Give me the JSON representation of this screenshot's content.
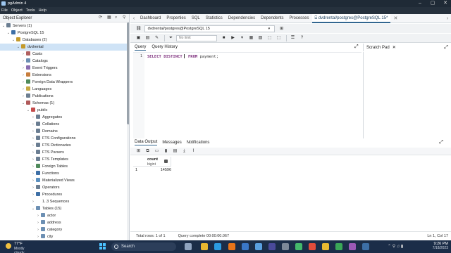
{
  "window": {
    "title": "pgAdmin 4"
  },
  "menu": {
    "items": [
      "File",
      "Object",
      "Tools",
      "Help"
    ]
  },
  "explorer": {
    "title": "Object Explorer",
    "tree": [
      {
        "label": "Servers (1)",
        "indent": 0,
        "expanded": true,
        "color": "#6a7d91"
      },
      {
        "label": "PostgreSQL 15",
        "indent": 1,
        "expanded": true,
        "color": "#3d6fa6"
      },
      {
        "label": "Databases (2)",
        "indent": 2,
        "expanded": true,
        "color": "#c49a2b"
      },
      {
        "label": "dvdrental",
        "indent": 3,
        "expanded": true,
        "color": "#c49a2b",
        "selected": true
      },
      {
        "label": "Casts",
        "indent": 4,
        "expanded": false,
        "color": "#b06060"
      },
      {
        "label": "Catalogs",
        "indent": 4,
        "expanded": false,
        "color": "#6c8fb3"
      },
      {
        "label": "Event Triggers",
        "indent": 4,
        "expanded": false,
        "color": "#8a6db0"
      },
      {
        "label": "Extensions",
        "indent": 4,
        "expanded": false,
        "color": "#c77d3c"
      },
      {
        "label": "Foreign Data Wrappers",
        "indent": 4,
        "expanded": false,
        "color": "#4f8a5b"
      },
      {
        "label": "Languages",
        "indent": 4,
        "expanded": false,
        "color": "#c6a842"
      },
      {
        "label": "Publications",
        "indent": 4,
        "expanded": false,
        "color": "#6d7f91"
      },
      {
        "label": "Schemas (1)",
        "indent": 4,
        "expanded": true,
        "color": "#b05a5a"
      },
      {
        "label": "public",
        "indent": 5,
        "expanded": true,
        "color": "#c44c4c"
      },
      {
        "label": "Aggregates",
        "indent": 6,
        "expanded": false,
        "color": "#6a7d91"
      },
      {
        "label": "Collations",
        "indent": 6,
        "expanded": false,
        "color": "#6a7d91"
      },
      {
        "label": "Domains",
        "indent": 6,
        "expanded": false,
        "color": "#6a7d91"
      },
      {
        "label": "FTS Configurations",
        "indent": 6,
        "expanded": false,
        "color": "#6a7d91"
      },
      {
        "label": "FTS Dictionaries",
        "indent": 6,
        "expanded": false,
        "color": "#6a7d91"
      },
      {
        "label": "FTS Parsers",
        "indent": 6,
        "expanded": false,
        "color": "#6a7d91"
      },
      {
        "label": "FTS Templates",
        "indent": 6,
        "expanded": false,
        "color": "#6a7d91"
      },
      {
        "label": "Foreign Tables",
        "indent": 6,
        "expanded": false,
        "color": "#4f8a5b"
      },
      {
        "label": "Functions",
        "indent": 6,
        "expanded": false,
        "color": "#3d6fa6"
      },
      {
        "label": "Materialized Views",
        "indent": 6,
        "expanded": false,
        "color": "#5a8fbf"
      },
      {
        "label": "Operators",
        "indent": 6,
        "expanded": false,
        "color": "#6a7d91"
      },
      {
        "label": "Procedures",
        "indent": 6,
        "expanded": false,
        "color": "#3d6fa6"
      },
      {
        "label": "1..3 Sequences",
        "indent": 6,
        "expanded": false,
        "color": "#ffffff"
      },
      {
        "label": "Tables (15)",
        "indent": 6,
        "expanded": true,
        "color": "#6c8fb3"
      },
      {
        "label": "actor",
        "indent": 7,
        "expanded": false,
        "color": "#6c8fb3"
      },
      {
        "label": "address",
        "indent": 7,
        "expanded": false,
        "color": "#6c8fb3"
      },
      {
        "label": "category",
        "indent": 7,
        "expanded": false,
        "color": "#6c8fb3"
      },
      {
        "label": "city",
        "indent": 7,
        "expanded": false,
        "color": "#6c8fb3"
      }
    ]
  },
  "tabs": [
    {
      "label": "Dashboard",
      "active": false
    },
    {
      "label": "Properties",
      "active": false
    },
    {
      "label": "SQL",
      "active": false
    },
    {
      "label": "Statistics",
      "active": false
    },
    {
      "label": "Dependencies",
      "active": false
    },
    {
      "label": "Dependents",
      "active": false
    },
    {
      "label": "Processes",
      "active": false
    },
    {
      "label": "dvdrental/postgres@PostgreSQL 15*",
      "active": true
    }
  ],
  "connection": {
    "value": "dvdrental/postgres@PostgreSQL 15"
  },
  "toolbar": {
    "limit": "No limit"
  },
  "query_tabs": {
    "query": "Query",
    "history": "Query History"
  },
  "scratch": {
    "title": "Scratch Pad"
  },
  "editor": {
    "line_number": "1",
    "code": {
      "select": "SELECT",
      "distinct": "DISTINCT",
      "from": "FROM",
      "table": "payment",
      "end": ";"
    }
  },
  "output_tabs": {
    "data": "Data Output",
    "messages": "Messages",
    "notifications": "Notifications"
  },
  "result": {
    "column": {
      "name": "count",
      "type": "bigint"
    },
    "rows": [
      {
        "num": "1",
        "value": "14596"
      }
    ]
  },
  "status": {
    "total_rows": "Total rows: 1 of 1",
    "query_status": "Query complete 00:00:00.067",
    "cursor": "Ln 1, Col 17"
  },
  "taskbar": {
    "weather_temp": "77°F",
    "weather_cond": "Mostly cloudy",
    "search": "Search",
    "time": "9:26 PM",
    "date": "7/18/2023"
  }
}
